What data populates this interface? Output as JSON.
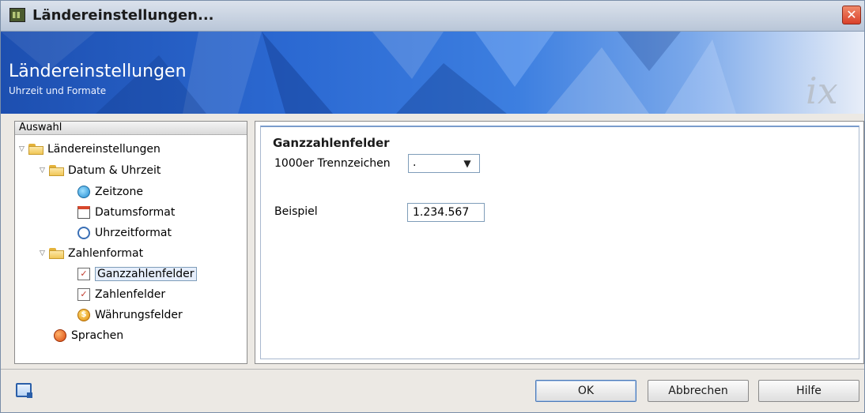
{
  "window": {
    "title": "Ländereinstellungen..."
  },
  "banner": {
    "title": "Ländereinstellungen",
    "subtitle": "Uhrzeit und Formate",
    "logo": "ix"
  },
  "tree": {
    "header": "Auswahl",
    "items": [
      {
        "label": "Ländereinstellungen",
        "icon": "folder-icon"
      },
      {
        "label": "Datum & Uhrzeit",
        "icon": "folder-icon"
      },
      {
        "label": "Zeitzone",
        "icon": "globe-icon"
      },
      {
        "label": "Datumsformat",
        "icon": "calendar-icon"
      },
      {
        "label": "Uhrzeitformat",
        "icon": "clock-icon"
      },
      {
        "label": "Zahlenformat",
        "icon": "folder-icon"
      },
      {
        "label": "Ganzzahlenfelder",
        "icon": "checklist-icon",
        "selected": true
      },
      {
        "label": "Zahlenfelder",
        "icon": "checklist-icon"
      },
      {
        "label": "Währungsfelder",
        "icon": "coin-icon"
      },
      {
        "label": "Sprachen",
        "icon": "language-icon"
      }
    ]
  },
  "content": {
    "section_title": "Ganzzahlenfelder",
    "separator_label": "1000er Trennzeichen",
    "separator_value": ".",
    "example_label": "Beispiel",
    "example_value": "1.234.567"
  },
  "buttons": {
    "ok": "OK",
    "cancel": "Abbrechen",
    "help": "Hilfe"
  },
  "colors": {
    "banner": "#2c6ad3",
    "selection": "#e6eefb",
    "close": "#d9412a"
  }
}
